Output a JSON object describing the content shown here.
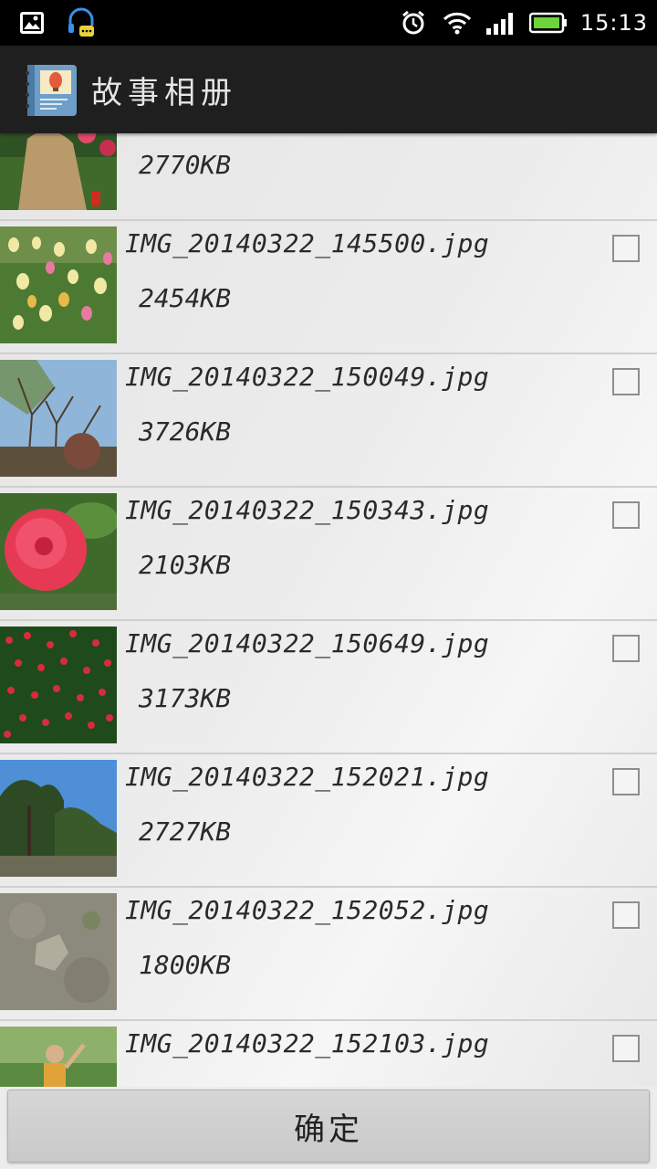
{
  "status_bar": {
    "time": "15:13",
    "left_icons": [
      "image-notification-icon",
      "headset-chat-icon"
    ],
    "right_icons": [
      "alarm-icon",
      "wifi-icon",
      "signal-icon",
      "battery-icon"
    ],
    "battery_color": "#6ed33a"
  },
  "action_bar": {
    "title": "故事相册",
    "icon": "photo-album-app-icon"
  },
  "list": {
    "items": [
      {
        "filename": "",
        "size": "2770KB",
        "checkbox": false,
        "thumb": "person-tulips"
      },
      {
        "filename": "IMG_20140322_145500.jpg",
        "size": "2454KB",
        "checkbox": true,
        "thumb": "tulip-field"
      },
      {
        "filename": "IMG_20140322_150049.jpg",
        "size": "3726KB",
        "checkbox": true,
        "thumb": "bare-trees-sky"
      },
      {
        "filename": "IMG_20140322_150343.jpg",
        "size": "2103KB",
        "checkbox": true,
        "thumb": "red-camellia"
      },
      {
        "filename": "IMG_20140322_150649.jpg",
        "size": "3173KB",
        "checkbox": true,
        "thumb": "camellia-bush"
      },
      {
        "filename": "IMG_20140322_152021.jpg",
        "size": "2727KB",
        "checkbox": true,
        "thumb": "pine-trees"
      },
      {
        "filename": "IMG_20140322_152052.jpg",
        "size": "1800KB",
        "checkbox": true,
        "thumb": "rock-ground"
      },
      {
        "filename": "IMG_20140322_152103.jpg",
        "size": "",
        "checkbox": true,
        "thumb": "person-trees"
      }
    ]
  },
  "footer": {
    "confirm_label": "确定"
  }
}
